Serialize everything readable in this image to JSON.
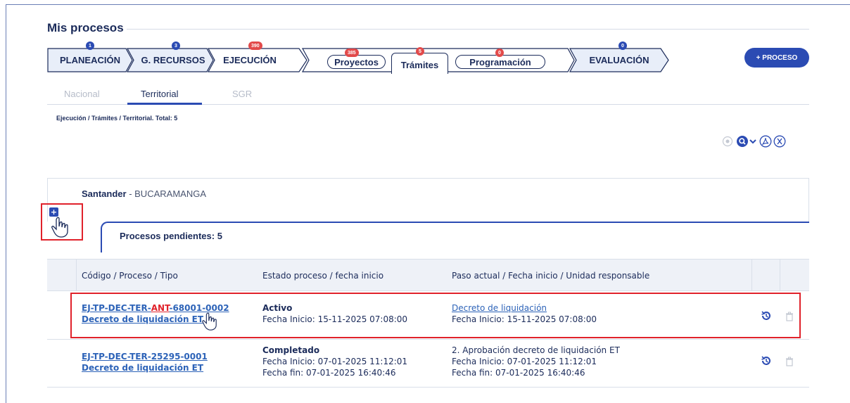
{
  "page": {
    "title": "Mis procesos"
  },
  "steps": [
    {
      "label": "PLANEACIÓN",
      "badge": "1"
    },
    {
      "label": "G. RECURSOS",
      "badge": "3"
    },
    {
      "label": "EJECUCIÓN",
      "badge": "390"
    },
    {
      "label": "EVALUACIÓN",
      "badge": "0"
    }
  ],
  "subtabs": [
    {
      "label": "Proyectos",
      "badge": "385"
    },
    {
      "label": "Trámites",
      "badge": "5"
    },
    {
      "label": "Programación",
      "badge": "0"
    }
  ],
  "new_process_button": "+ PROCESO",
  "tabs": [
    {
      "label": "Nacional"
    },
    {
      "label": "Territorial"
    },
    {
      "label": "SGR"
    }
  ],
  "breadcrumb": "Ejecución / Trámites / Territorial. Total: 5",
  "toolbar_icons": [
    "add-circle-icon",
    "search-icon",
    "chevron-down-icon",
    "pdf-icon",
    "excel-icon"
  ],
  "group": {
    "department": "Santander",
    "separator": " - ",
    "city": "BUCARAMANGA"
  },
  "pending": {
    "label": "Procesos pendientes: 5"
  },
  "table": {
    "headers": [
      "Código / Proceso / Tipo",
      "Estado proceso / fecha inicio",
      "Paso actual / Fecha inicio / Unidad responsable"
    ],
    "rows": [
      {
        "code_prefix": "EJ-TP-DEC-TER-",
        "code_mid": "ANT",
        "code_suffix": "-68001-0002",
        "process": "Decreto de liquidación ET",
        "status": "Activo",
        "status_start": "Fecha Inicio: 15-11-2025 07:08:00",
        "status_end": "",
        "step": "Decreto de liquidación",
        "step_start": "Fecha Inicio: 15-11-2025 07:08:00",
        "step_end": ""
      },
      {
        "code_prefix": "EJ-TP-DEC-TER-25295-0001",
        "code_mid": "",
        "code_suffix": "",
        "process": "Decreto de liquidación ET",
        "status": "Completado",
        "status_start": "Fecha Inicio: 07-01-2025 11:12:01",
        "status_end": "Fecha fin: 07-01-2025 16:40:46",
        "step": "2. Aprobación decreto de liquidación ET",
        "step_start": "Fecha Inicio: 07-01-2025 11:12:01",
        "step_end": "Fecha fin: 07-01-2025 16:40:46"
      }
    ]
  },
  "colors": {
    "primary": "#2b4bb3",
    "navy": "#1b2b5a",
    "link": "#2d63b8",
    "highlight": "#e0222b",
    "badge": "#e24a4a"
  }
}
